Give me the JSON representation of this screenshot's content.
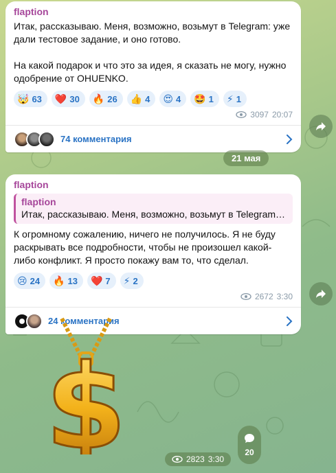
{
  "post1": {
    "sender": "flaption",
    "text": "Итак, рассказываю. Меня, возможно, возьмут в Telegram: уже дали тестовое задание, и оно готово.\n\nНа какой подарок и что это за идея, я сказать не могу, нужно одобрение от OHUENKO.",
    "reactions": [
      {
        "emoji": "🤯",
        "count": "63"
      },
      {
        "emoji": "❤️",
        "count": "30"
      },
      {
        "emoji": "🔥",
        "count": "26"
      },
      {
        "emoji": "👍",
        "count": "4"
      },
      {
        "emoji": "😍",
        "count": "4"
      },
      {
        "emoji": "🤩",
        "count": "1"
      },
      {
        "emoji": "⚡",
        "count": "1"
      }
    ],
    "views": "3097",
    "time": "20:07",
    "comments": "74 комментария"
  },
  "date_separator": "21 мая",
  "post2": {
    "sender": "flaption",
    "quote_sender": "flaption",
    "quote_text": "Итак, рассказываю. Меня, возможно, возьмут в Telegram: уж...",
    "text": "К огромному сожалению, ничего не получилось. Я не буду раскрывать все подробности, чтобы не произошел какой-либо конфликт. Я просто покажу вам то, что сделал.",
    "reactions": [
      {
        "emoji": "😢",
        "count": "24"
      },
      {
        "emoji": "🔥",
        "count": "13"
      },
      {
        "emoji": "❤️",
        "count": "7"
      },
      {
        "emoji": "⚡",
        "count": "2"
      }
    ],
    "views": "2672",
    "time": "3:30",
    "comments": "24 комментария"
  },
  "sticker": {
    "symbol": "$",
    "views": "2823",
    "time": "3:30",
    "comments_count": "20"
  },
  "colors": {
    "sender": "#a6469a",
    "link": "#2a73c4",
    "reaction_bg": "#e6f0fb"
  }
}
